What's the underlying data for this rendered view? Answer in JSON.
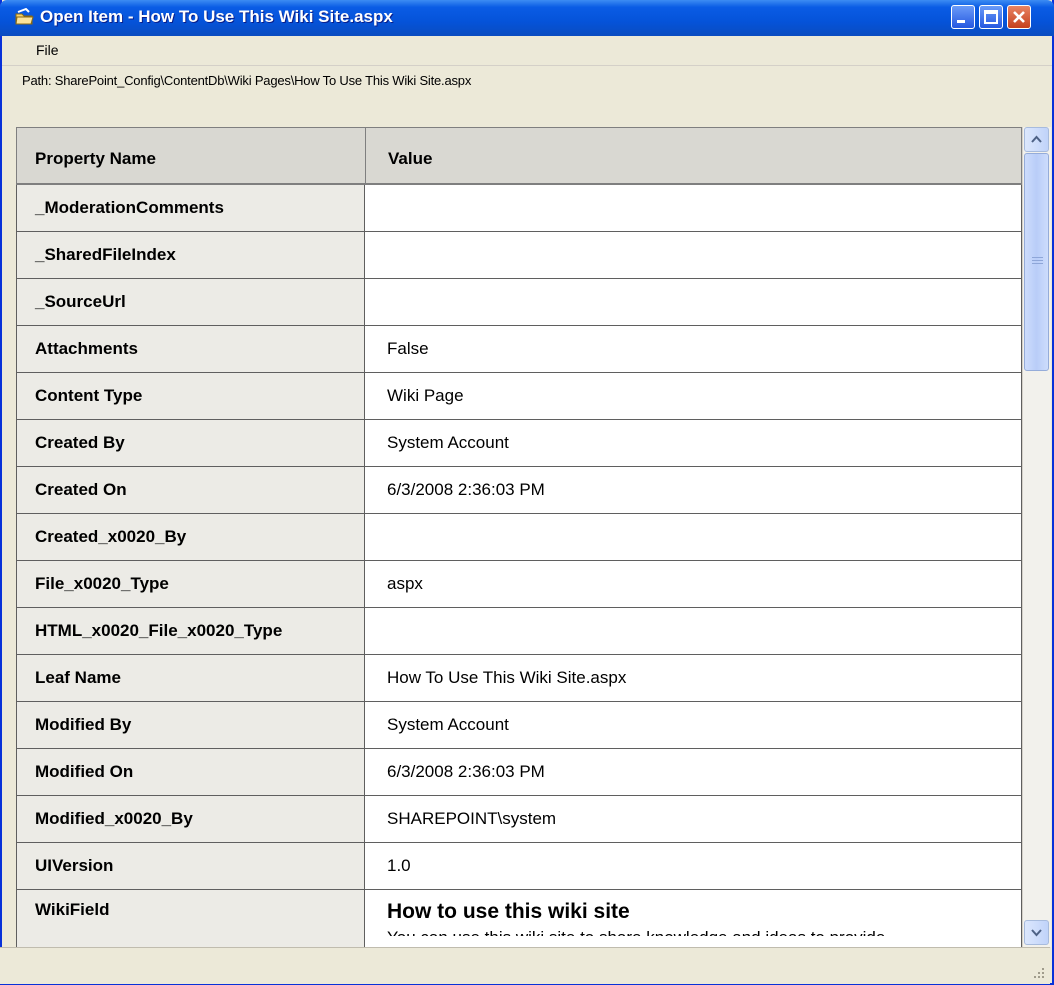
{
  "window": {
    "title": "Open Item - How To Use This Wiki Site.aspx",
    "title_icon": "open-item-icon"
  },
  "menu": {
    "items": [
      "File"
    ]
  },
  "path": {
    "text": "Path:  SharePoint_Config\\ContentDb\\Wiki Pages\\How To Use This Wiki Site.aspx"
  },
  "grid": {
    "headers": {
      "name": "Property Name",
      "value": "Value"
    },
    "rows": [
      {
        "name": "_ModerationComments",
        "value": ""
      },
      {
        "name": "_SharedFileIndex",
        "value": ""
      },
      {
        "name": "_SourceUrl",
        "value": ""
      },
      {
        "name": "Attachments",
        "value": "False"
      },
      {
        "name": "Content Type",
        "value": "Wiki Page"
      },
      {
        "name": "Created By",
        "value": "System Account"
      },
      {
        "name": "Created On",
        "value": "6/3/2008 2:36:03 PM"
      },
      {
        "name": "Created_x0020_By",
        "value": ""
      },
      {
        "name": "File_x0020_Type",
        "value": "aspx"
      },
      {
        "name": "HTML_x0020_File_x0020_Type",
        "value": ""
      },
      {
        "name": "Leaf Name",
        "value": "How To Use This Wiki Site.aspx"
      },
      {
        "name": "Modified By",
        "value": "System Account"
      },
      {
        "name": "Modified On",
        "value": "6/3/2008 2:36:03 PM"
      },
      {
        "name": "Modified_x0020_By",
        "value": "SHAREPOINT\\system"
      },
      {
        "name": "UIVersion",
        "value": "1.0"
      }
    ],
    "wiki_row": {
      "name": "WikiField",
      "heading": "How to use this wiki site",
      "body": "You can use this wiki site to share knowledge and ideas to provide"
    }
  },
  "colors": {
    "titlebar": "#0553D9",
    "window_bg": "#ECE9D8",
    "name_cell_bg": "#ECEBE6",
    "header_bg": "#D9D8D2"
  }
}
